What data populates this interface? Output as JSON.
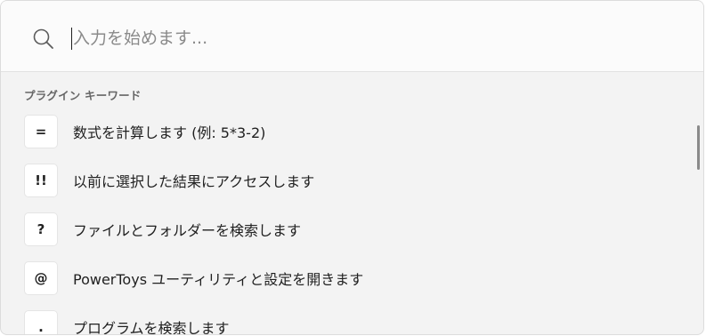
{
  "search": {
    "placeholder": "入力を始めます..."
  },
  "section": {
    "header": "プラグイン キーワード"
  },
  "items": [
    {
      "key": "=",
      "text": "数式を計算します (例: 5*3-2)"
    },
    {
      "key": "!!",
      "text": "以前に選択した結果にアクセスします"
    },
    {
      "key": "?",
      "text": "ファイルとフォルダーを検索します"
    },
    {
      "key": "@",
      "text": "PowerToys ユーティリティと設定を開きます"
    },
    {
      "key": ".",
      "text": "プログラムを検索します"
    }
  ],
  "icons": {
    "search": "search-icon"
  },
  "colors": {
    "background": "#f3f3f3",
    "search_background": "#fbfbfb",
    "key_background": "#ffffff"
  }
}
